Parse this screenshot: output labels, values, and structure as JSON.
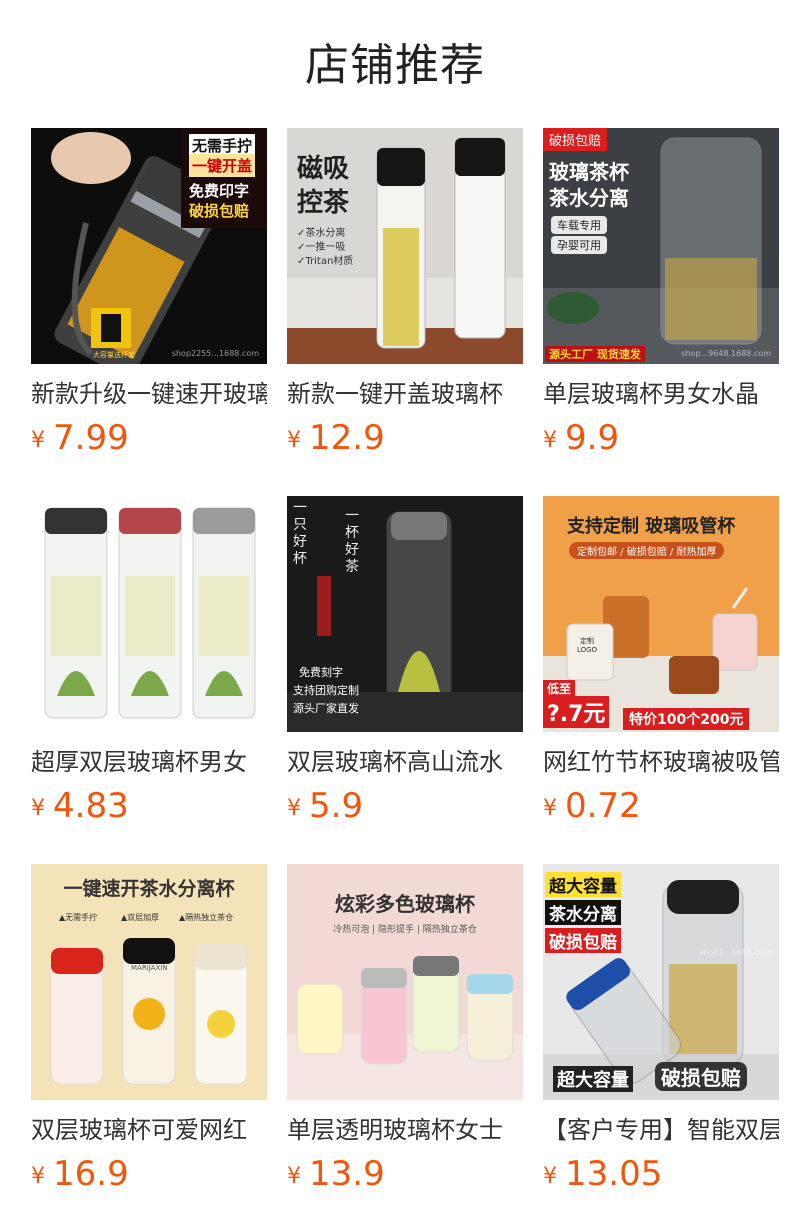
{
  "page": {
    "title": "店铺推荐"
  },
  "currency_symbol": "¥",
  "products": [
    {
      "name": "新款升级一键速开玻璃",
      "price": "7.99",
      "image": {
        "badges": [
          "无需手拧",
          "一键开盖",
          "免费印字",
          "破损包赔",
          "大容量送杯套"
        ],
        "watermark": "shop2255...1688.com"
      }
    },
    {
      "name": "新款一键开盖玻璃杯",
      "price": "12.9",
      "image": {
        "badges": [
          "磁吸",
          "控茶",
          "✓茶水分离",
          "✓一推一吸",
          "✓Tritan材质"
        ]
      }
    },
    {
      "name": "单层玻璃杯男女水晶",
      "price": "9.9",
      "image": {
        "badges": [
          "破损包赔",
          "玻璃茶杯",
          "茶水分离",
          "车载专用",
          "孕婴可用",
          "源头工厂 现货速发"
        ],
        "watermark": "shop...9648.1688.com"
      }
    },
    {
      "name": "超厚双层玻璃杯男女",
      "price": "4.83",
      "image": {
        "badges": []
      }
    },
    {
      "name": "双层玻璃杯高山流水",
      "price": "5.9",
      "image": {
        "badges": [
          "一只好杯",
          "一杯好茶",
          "免费刻字",
          "支持团购定制",
          "源头厂家直发"
        ]
      }
    },
    {
      "name": "网红竹节杯玻璃被吸管",
      "price": "0.72",
      "image": {
        "badges": [
          "支持定制 玻璃吸管杯",
          "定制包邮 / 破损包赔 / 耐热加厚",
          "低至",
          "?.7元",
          "特价100个200元",
          "定制 LOGO"
        ]
      }
    },
    {
      "name": "双层玻璃杯可爱网红",
      "price": "16.9",
      "image": {
        "badges": [
          "一键速开茶水分离杯",
          "▲无需手拧",
          "▲双层加厚",
          "▲隔热独立茶仓",
          "MARIJAXIN"
        ]
      }
    },
    {
      "name": "单层透明玻璃杯女士",
      "price": "13.9",
      "image": {
        "badges": [
          "炫彩多色玻璃杯",
          "冷热可泡 | 隐形提手 | 隔热独立茶仓"
        ]
      }
    },
    {
      "name": "【客户专用】智能双层",
      "price": "13.05",
      "image": {
        "badges": [
          "超大容量",
          "茶水分离",
          "破损包赔",
          "超大容量",
          "破损包赔"
        ],
        "watermark": "shop2...1688.com"
      }
    }
  ],
  "colors": {
    "price": "#f0570b",
    "title": "#222222",
    "name": "#333333"
  }
}
